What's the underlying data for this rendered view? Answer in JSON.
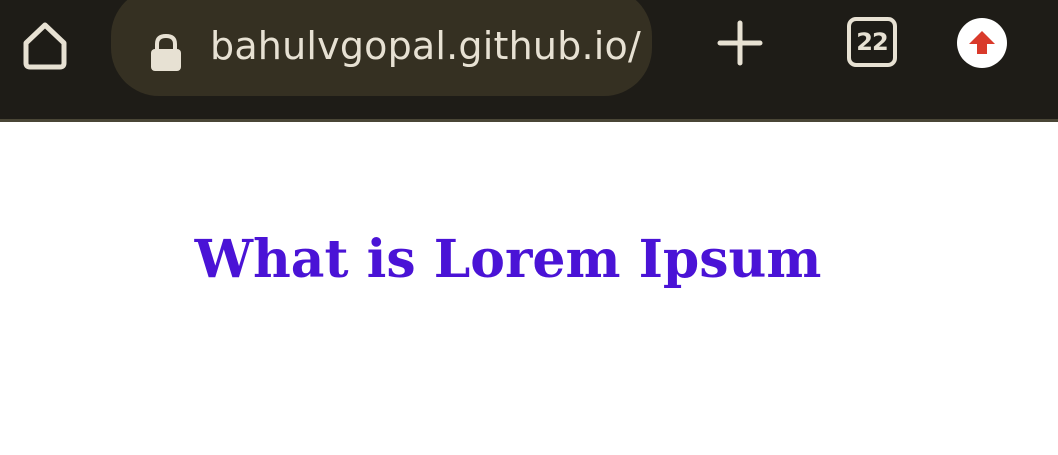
{
  "browser": {
    "url": "bahulvgopal.github.io/",
    "tab_count": "22",
    "icons": {
      "home": "home-icon",
      "lock": "lock-icon",
      "new_tab": "plus-icon",
      "tabs": "tab-switcher-icon",
      "update": "update-arrow-icon"
    },
    "colors": {
      "toolbar_bg": "#1e1c17",
      "url_bar_bg": "#353022",
      "icon": "#e7e1d3",
      "update_arrow": "#d93a2b"
    }
  },
  "page": {
    "heading": "What is Lorem Ipsum",
    "heading_color": "#4a13d6"
  }
}
